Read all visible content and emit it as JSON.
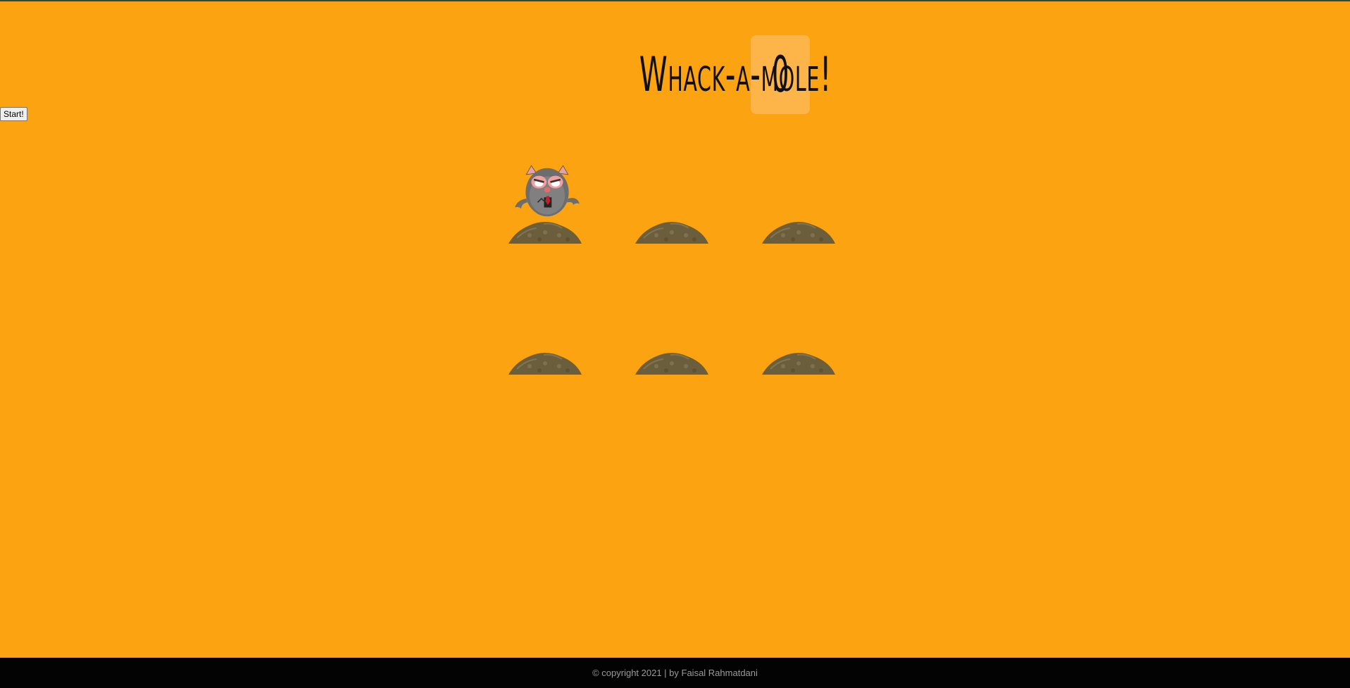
{
  "app": {
    "start_label": "Start!"
  },
  "header": {
    "title": "Whack-a-mole!",
    "score": "0"
  },
  "board": {
    "holes": [
      {
        "id": "hole-1",
        "mole_up": true
      },
      {
        "id": "hole-2",
        "mole_up": false
      },
      {
        "id": "hole-3",
        "mole_up": false
      },
      {
        "id": "hole-4",
        "mole_up": false
      },
      {
        "id": "hole-5",
        "mole_up": false
      },
      {
        "id": "hole-6",
        "mole_up": false
      }
    ]
  },
  "footer": {
    "text": "© copyright 2021 | by Faisal Rahmatdani"
  },
  "colors": {
    "background": "#fca311",
    "score_box": "#fdb54a",
    "footer_bg": "#030303",
    "dirt": "#6b5e3c"
  }
}
